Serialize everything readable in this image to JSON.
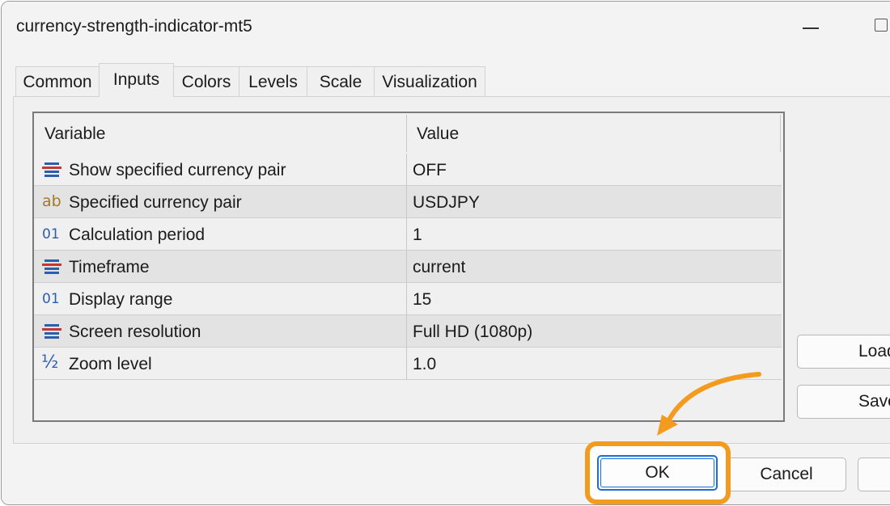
{
  "window": {
    "title": "currency-strength-indicator-mt5"
  },
  "tabs": [
    {
      "label": "Common"
    },
    {
      "label": "Inputs"
    },
    {
      "label": "Colors"
    },
    {
      "label": "Levels"
    },
    {
      "label": "Scale"
    },
    {
      "label": "Visualization"
    }
  ],
  "active_tab": "Inputs",
  "grid": {
    "col_variable": "Variable",
    "col_value": "Value",
    "rows": [
      {
        "icon": "enum-icon",
        "name": "Show specified currency pair",
        "value": "OFF"
      },
      {
        "icon": "string-icon",
        "glyph": "ab",
        "name": "Specified currency pair",
        "value": "USDJPY"
      },
      {
        "icon": "integer-icon",
        "glyph": "01",
        "name": "Calculation period",
        "value": "1"
      },
      {
        "icon": "enum-icon",
        "name": "Timeframe",
        "value": "current"
      },
      {
        "icon": "integer-icon",
        "glyph": "01",
        "name": "Display range",
        "value": "15"
      },
      {
        "icon": "enum-icon",
        "name": "Screen resolution",
        "value": "Full HD (1080p)"
      },
      {
        "icon": "double-icon",
        "glyph": "½",
        "name": "Zoom level",
        "value": "1.0"
      }
    ]
  },
  "side_buttons": {
    "load": "Load",
    "save": "Save"
  },
  "footer": {
    "ok": "OK",
    "cancel": "Cancel",
    "reset": ""
  },
  "colors": {
    "highlight": "#f39b1f",
    "focus": "#1a6fd6"
  }
}
